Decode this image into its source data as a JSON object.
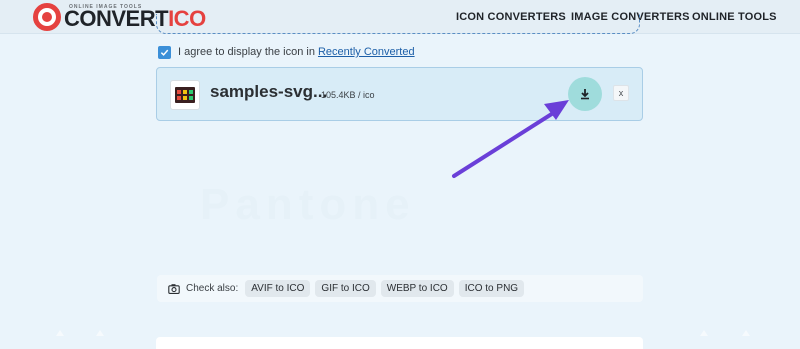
{
  "header": {
    "logo_tagline": "ONLINE IMAGE TOOLS",
    "logo_text_main": "CONVERT",
    "logo_text_accent": "ICO",
    "nav": [
      {
        "label": "ICON CONVERTERS"
      },
      {
        "label": "IMAGE CONVERTERS"
      },
      {
        "label": "ONLINE TOOLS"
      }
    ]
  },
  "agree": {
    "checked": true,
    "text": "I agree to display the icon in",
    "link": "Recently Converted"
  },
  "file": {
    "name": "samples-svg...",
    "meta": "105.4KB / ico",
    "close_label": "x"
  },
  "watermark": "Pantone",
  "check_also": {
    "label": "Check also:",
    "chips": [
      "AVIF to ICO",
      "GIF to ICO",
      "WEBP to ICO",
      "ICO to PNG"
    ]
  },
  "colors": {
    "brand_red": "#e5413f",
    "download_bg": "#9fdcdc",
    "arrow": "#6a3fd8",
    "link": "#1d5fa8",
    "checkbox": "#3b8fd8"
  },
  "icons": {
    "download": "download-icon",
    "camera": "camera-icon",
    "check": "checkmark-icon",
    "arrow": "pointer-arrow"
  }
}
